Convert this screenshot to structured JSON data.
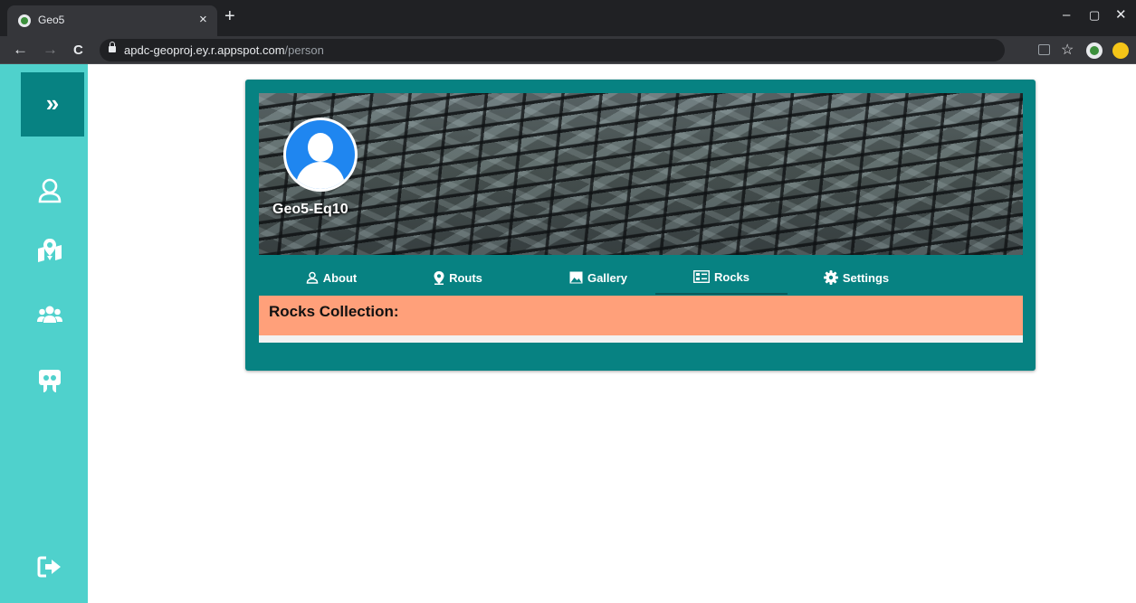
{
  "browser": {
    "tab_title": "Geo5",
    "tab_close": "×",
    "new_tab": "+",
    "url_host": "apdc-geoproj.ey.r.appspot.com",
    "url_path": "/person",
    "back": "←",
    "forward": "→",
    "reload": "C",
    "minimize": "–",
    "restore": "▢",
    "close": "✕",
    "bookmark": "☆"
  },
  "sidebar": {
    "expand_label": "»",
    "items": [
      {
        "icon": "user-icon"
      },
      {
        "icon": "map-marker-icon"
      },
      {
        "icon": "users-icon"
      },
      {
        "icon": "slideshare-icon"
      },
      {
        "icon": "sign-out-icon"
      }
    ]
  },
  "profile": {
    "username": "Geo5-Eq10",
    "tabs": [
      {
        "label": "About",
        "icon": "user-icon",
        "active": false
      },
      {
        "label": "Routs",
        "icon": "map-marker-icon",
        "active": false
      },
      {
        "label": "Gallery",
        "icon": "image-icon",
        "active": false
      },
      {
        "label": "Rocks",
        "icon": "list-card-icon",
        "active": true
      },
      {
        "label": "Settings",
        "icon": "cog-icon",
        "active": false
      }
    ],
    "section_title": "Rocks Collection:"
  },
  "colors": {
    "sidebar": "#4fd1cc",
    "sidebar_active": "#078282",
    "card": "#078282",
    "section_header": "#ffa07a",
    "avatar": "#1f86f0"
  }
}
